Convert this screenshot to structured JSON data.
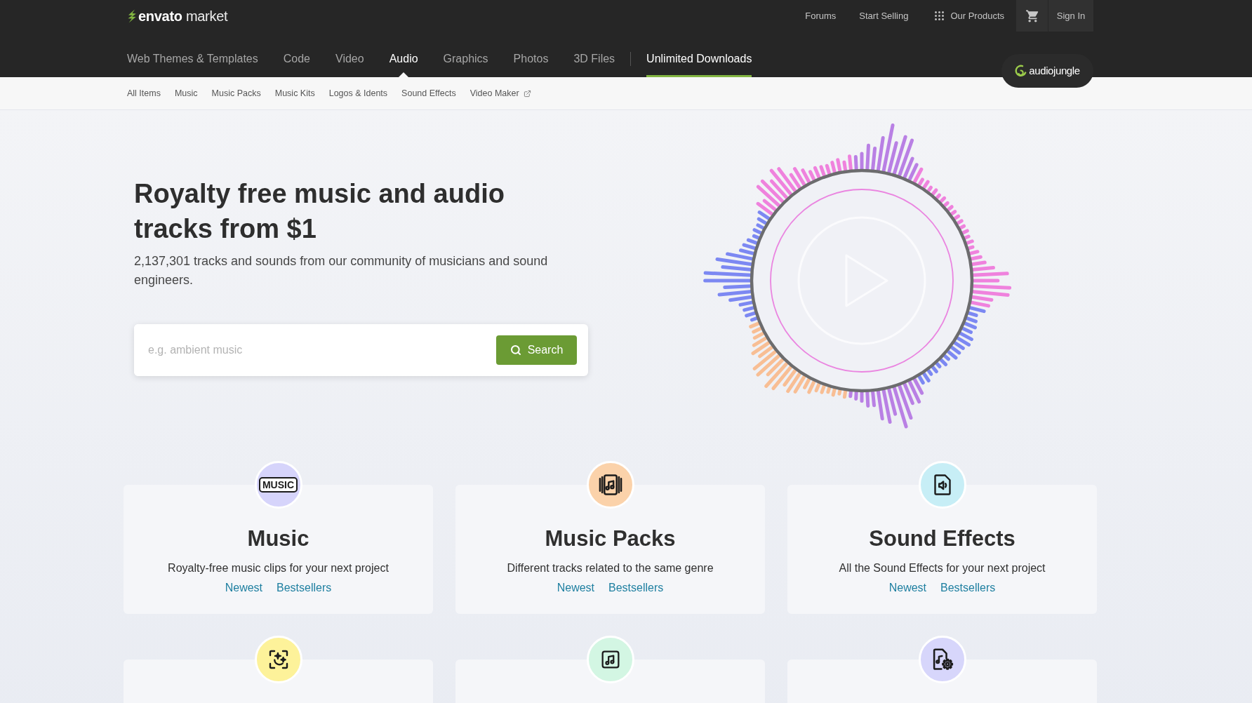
{
  "header": {
    "logo": "**envato** market",
    "links": [
      "Forums",
      "Start Selling"
    ],
    "products_menu": "Our Products",
    "sign_in": "Sign In"
  },
  "tabs": [
    {
      "label": "Web Themes & Templates",
      "kind": "category",
      "selected": false
    },
    {
      "label": "Code",
      "kind": "category",
      "selected": false
    },
    {
      "label": "Video",
      "kind": "category",
      "selected": false
    },
    {
      "label": "Audio",
      "kind": "category",
      "selected": true
    },
    {
      "label": "Graphics",
      "kind": "category",
      "selected": false
    },
    {
      "label": "Photos",
      "kind": "category",
      "selected": false
    },
    {
      "label": "3D Files",
      "kind": "category",
      "selected": false
    },
    {
      "label": "Unlimited Downloads",
      "kind": "promo",
      "selected": false
    }
  ],
  "site_badge": "audiojungle",
  "subnav": [
    {
      "label": "All Items",
      "external": false
    },
    {
      "label": "Music",
      "external": false
    },
    {
      "label": "Music Packs",
      "external": false
    },
    {
      "label": "Music Kits",
      "external": false
    },
    {
      "label": "Logos & Idents",
      "external": false
    },
    {
      "label": "Sound Effects",
      "external": false
    },
    {
      "label": "Video Maker",
      "external": true
    }
  ],
  "hero": {
    "title": "Royalty free music and audio tracks from $1",
    "subtitle": "2,137,301 tracks and sounds from our community of musicians and sound engineers.",
    "search": {
      "placeholder": "e.g. ambient music",
      "button": "Search"
    }
  },
  "categories": [
    {
      "icon_text": "MUSIC",
      "color": "#d6d4fb",
      "title": "Music",
      "description": "Royalty-free music clips for your next project",
      "links": [
        "Newest",
        "Bestsellers"
      ]
    },
    {
      "color": "#fbd2aa",
      "title": "Music Packs",
      "description": "Different tracks related to the same genre",
      "links": [
        "Newest",
        "Bestsellers"
      ]
    },
    {
      "color": "#c7eef6",
      "title": "Sound Effects",
      "description": "All the Sound Effects for your next project",
      "links": [
        "Newest",
        "Bestsellers"
      ]
    },
    {
      "color": "#fdf29a"
    },
    {
      "color": "#d3f6e3"
    },
    {
      "color": "#d7d6fb"
    }
  ]
}
